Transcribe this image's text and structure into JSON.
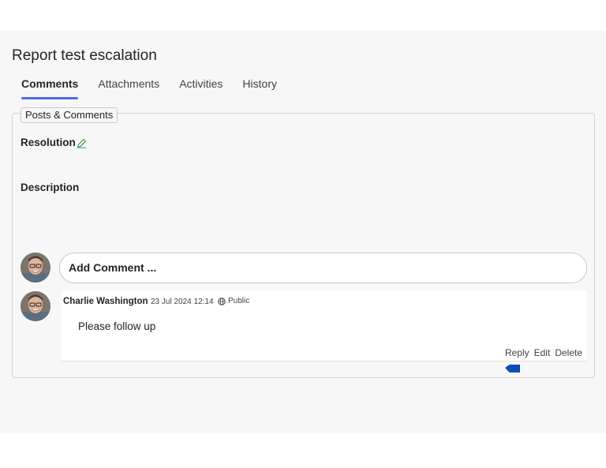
{
  "record": {
    "title": "Report test escalation"
  },
  "tabs": [
    {
      "label": "Comments",
      "active": true
    },
    {
      "label": "Attachments",
      "active": false
    },
    {
      "label": "Activities",
      "active": false
    },
    {
      "label": "History",
      "active": false
    }
  ],
  "panel": {
    "legend": "Posts & Comments",
    "resolution_label": "Resolution",
    "description_label": "Description",
    "add_comment_placeholder": "Add Comment ..."
  },
  "comments": [
    {
      "author": "Charlie Washington",
      "date": "23 Jul 2024 12:14",
      "visibility": "Public",
      "text": "Please follow up",
      "actions": {
        "reply": "Reply",
        "edit": "Edit",
        "delete": "Delete"
      }
    }
  ],
  "icons": {
    "edit": "pencil-icon",
    "visibility": "globe-icon"
  },
  "colors": {
    "accent": "#4f6bed",
    "edit_icon": "#3a9a4a",
    "cursor": "#0b4db4"
  }
}
